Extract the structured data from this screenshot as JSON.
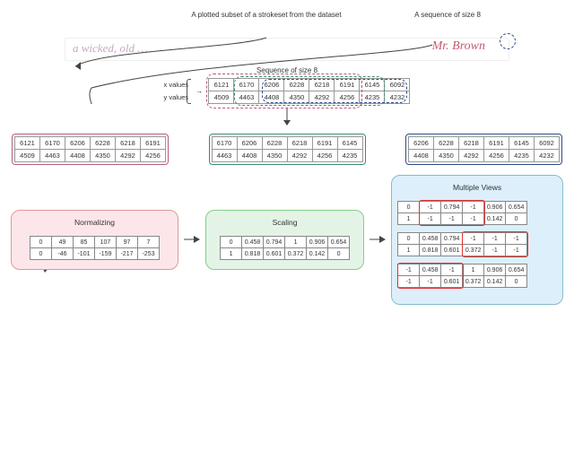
{
  "top": {
    "title_left": "A plotted subset of a strokeset\nfrom the dataset",
    "title_right": "A sequence of\nsize 8",
    "hw_left": "a wicked, old …",
    "hw_right": "Mr. Brown"
  },
  "seq_label": "Sequence of size 8",
  "row_labels": {
    "x": "x values",
    "y": "y values"
  },
  "sequence": {
    "x": [
      "6121",
      "6170",
      "6206",
      "6228",
      "6218",
      "6191",
      "6145",
      "6092"
    ],
    "y": [
      "4509",
      "4463",
      "4408",
      "4350",
      "4292",
      "4256",
      "4235",
      "4232"
    ]
  },
  "overlay_colors": {
    "a": "#b85a82",
    "b": "#3d8c6d",
    "c": "#2c4c88"
  },
  "subseqs": [
    {
      "color": "#b85a82",
      "x": [
        "6121",
        "6170",
        "6206",
        "6228",
        "6218",
        "6191"
      ],
      "y": [
        "4509",
        "4463",
        "4408",
        "4350",
        "4292",
        "4256"
      ]
    },
    {
      "color": "#3d8c6d",
      "x": [
        "6170",
        "6206",
        "6228",
        "6218",
        "6191",
        "6145"
      ],
      "y": [
        "4463",
        "4408",
        "4350",
        "4292",
        "4256",
        "4235"
      ]
    },
    {
      "color": "#2c4c88",
      "x": [
        "6206",
        "6228",
        "6218",
        "6191",
        "6145",
        "6092"
      ],
      "y": [
        "4408",
        "4350",
        "4292",
        "4256",
        "4235",
        "4232"
      ]
    }
  ],
  "stages": {
    "norm_title": "Normalizing",
    "scale_title": "Scaling",
    "mv_title": "Multiple Views"
  },
  "normalizing": {
    "x": [
      "0",
      "49",
      "85",
      "107",
      "97",
      "7"
    ],
    "y": [
      "0",
      "-46",
      "-101",
      "-159",
      "-217",
      "-253"
    ]
  },
  "scaling": {
    "x": [
      "0",
      "0.458",
      "0.794",
      "1",
      "0.906",
      "0.654"
    ],
    "y": [
      "1",
      "0.818",
      "0.601",
      "0.372",
      "0.142",
      "0"
    ]
  },
  "views": [
    {
      "x": [
        "0",
        "-1",
        "0.794",
        "-1",
        "0.906",
        "0.654"
      ],
      "y": [
        "1",
        "-1",
        "-1",
        "-1",
        "0.142",
        "0"
      ],
      "mask_cols": [
        1,
        2,
        3
      ]
    },
    {
      "x": [
        "0",
        "0.458",
        "0.794",
        "-1",
        "-1",
        "-1"
      ],
      "y": [
        "1",
        "0.818",
        "0.601",
        "0.372",
        "-1",
        "-1"
      ],
      "mask_cols": [
        3,
        4,
        5
      ]
    },
    {
      "x": [
        "-1",
        "0.458",
        "-1",
        "1",
        "0.906",
        "0.654"
      ],
      "y": [
        "-1",
        "-1",
        "0.601",
        "0.372",
        "0.142",
        "0"
      ],
      "mask_cols": [
        0,
        1,
        2
      ]
    }
  ],
  "chart_data": {
    "type": "table",
    "title": "Preprocessing pipeline for a sequence of size 8",
    "raw_sequence": {
      "x": [
        6121,
        6170,
        6206,
        6228,
        6218,
        6191,
        6145,
        6092
      ],
      "y": [
        4509,
        4463,
        4408,
        4350,
        4292,
        4256,
        4235,
        4232
      ]
    },
    "sliding_windows_size6": [
      {
        "x": [
          6121,
          6170,
          6206,
          6228,
          6218,
          6191
        ],
        "y": [
          4509,
          4463,
          4408,
          4350,
          4292,
          4256
        ]
      },
      {
        "x": [
          6170,
          6206,
          6228,
          6218,
          6191,
          6145
        ],
        "y": [
          4463,
          4408,
          4350,
          4292,
          4256,
          4235
        ]
      },
      {
        "x": [
          6206,
          6228,
          6218,
          6191,
          6145,
          6092
        ],
        "y": [
          4408,
          4350,
          4292,
          4256,
          4235,
          4232
        ]
      }
    ],
    "normalizing": {
      "x": [
        0,
        49,
        85,
        107,
        97,
        7
      ],
      "y": [
        0,
        -46,
        -101,
        -159,
        -217,
        -253
      ]
    },
    "scaling": {
      "x": [
        0,
        0.458,
        0.794,
        1,
        0.906,
        0.654
      ],
      "y": [
        1,
        0.818,
        0.601,
        0.372,
        0.142,
        0
      ]
    },
    "multiple_views": [
      {
        "x": [
          0,
          -1,
          0.794,
          -1,
          0.906,
          0.654
        ],
        "y": [
          1,
          -1,
          -1,
          -1,
          0.142,
          0
        ],
        "masked_columns": [
          1,
          2,
          3
        ]
      },
      {
        "x": [
          0,
          0.458,
          0.794,
          -1,
          -1,
          -1
        ],
        "y": [
          1,
          0.818,
          0.601,
          0.372,
          -1,
          -1
        ],
        "masked_columns": [
          3,
          4,
          5
        ]
      },
      {
        "x": [
          -1,
          0.458,
          -1,
          1,
          0.906,
          0.654
        ],
        "y": [
          -1,
          -1,
          0.601,
          0.372,
          0.142,
          0
        ],
        "masked_columns": [
          0,
          1,
          2
        ]
      }
    ]
  }
}
